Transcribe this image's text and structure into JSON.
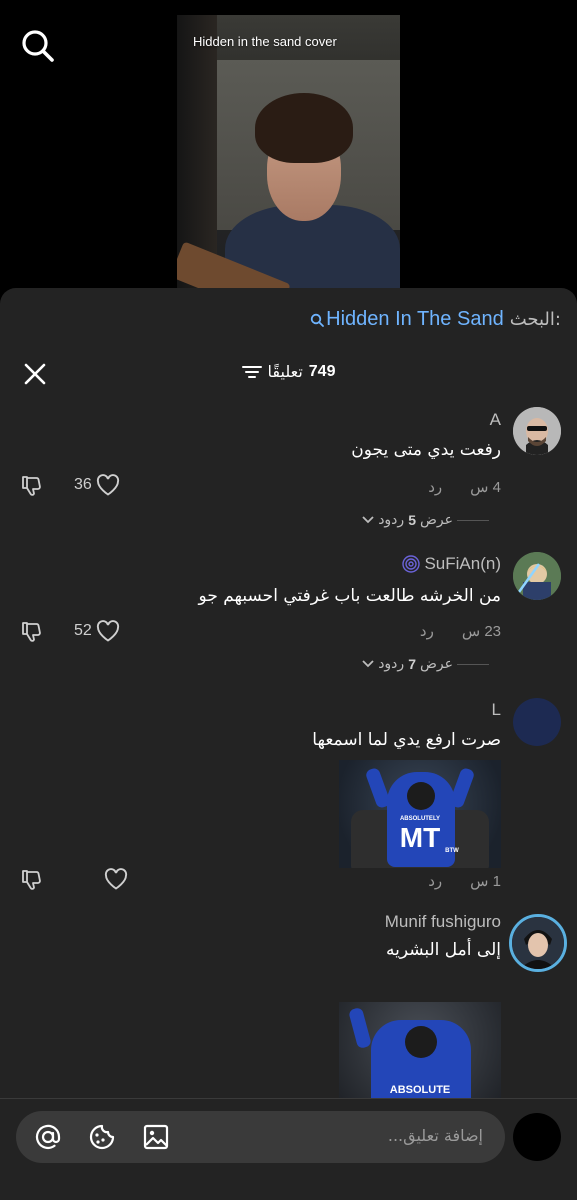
{
  "video": {
    "caption": "Hidden in the sand cover",
    "search_icon": "search-icon"
  },
  "search": {
    "label": "البحث:",
    "query": "Hidden In The Sand"
  },
  "header": {
    "count": "749",
    "count_label": "تعليقًا"
  },
  "comments": [
    {
      "author": "A",
      "text": "رفعت يدي متى يجون",
      "time": "4 س",
      "reply_label": "رد",
      "likes": "36",
      "replies_label": "عرض",
      "replies_count": "5",
      "replies_unit": "ردود"
    },
    {
      "author": "SuFiAn(n)",
      "text": "من الخرشه طالعت باب غرفتي احسبهم جو",
      "time": "23 س",
      "reply_label": "رد",
      "likes": "52",
      "replies_label": "عرض",
      "replies_count": "7",
      "replies_unit": "ردود"
    },
    {
      "author": "L",
      "text": "صرت ارفع يدي لما اسمعها",
      "time": "1 س",
      "reply_label": "رد",
      "likes": "",
      "meme_top": "ABSOLUTELY",
      "meme_big": "MT",
      "meme_small": "BTW"
    },
    {
      "author": "Munif fushiguro",
      "text": "إلى أمل البشريه",
      "meme_top": "ABSOLUTE"
    }
  ],
  "composer": {
    "placeholder": "إضافة تعليق..."
  },
  "colors": {
    "panel": "#232323",
    "accent_link": "#6fb4ff"
  }
}
